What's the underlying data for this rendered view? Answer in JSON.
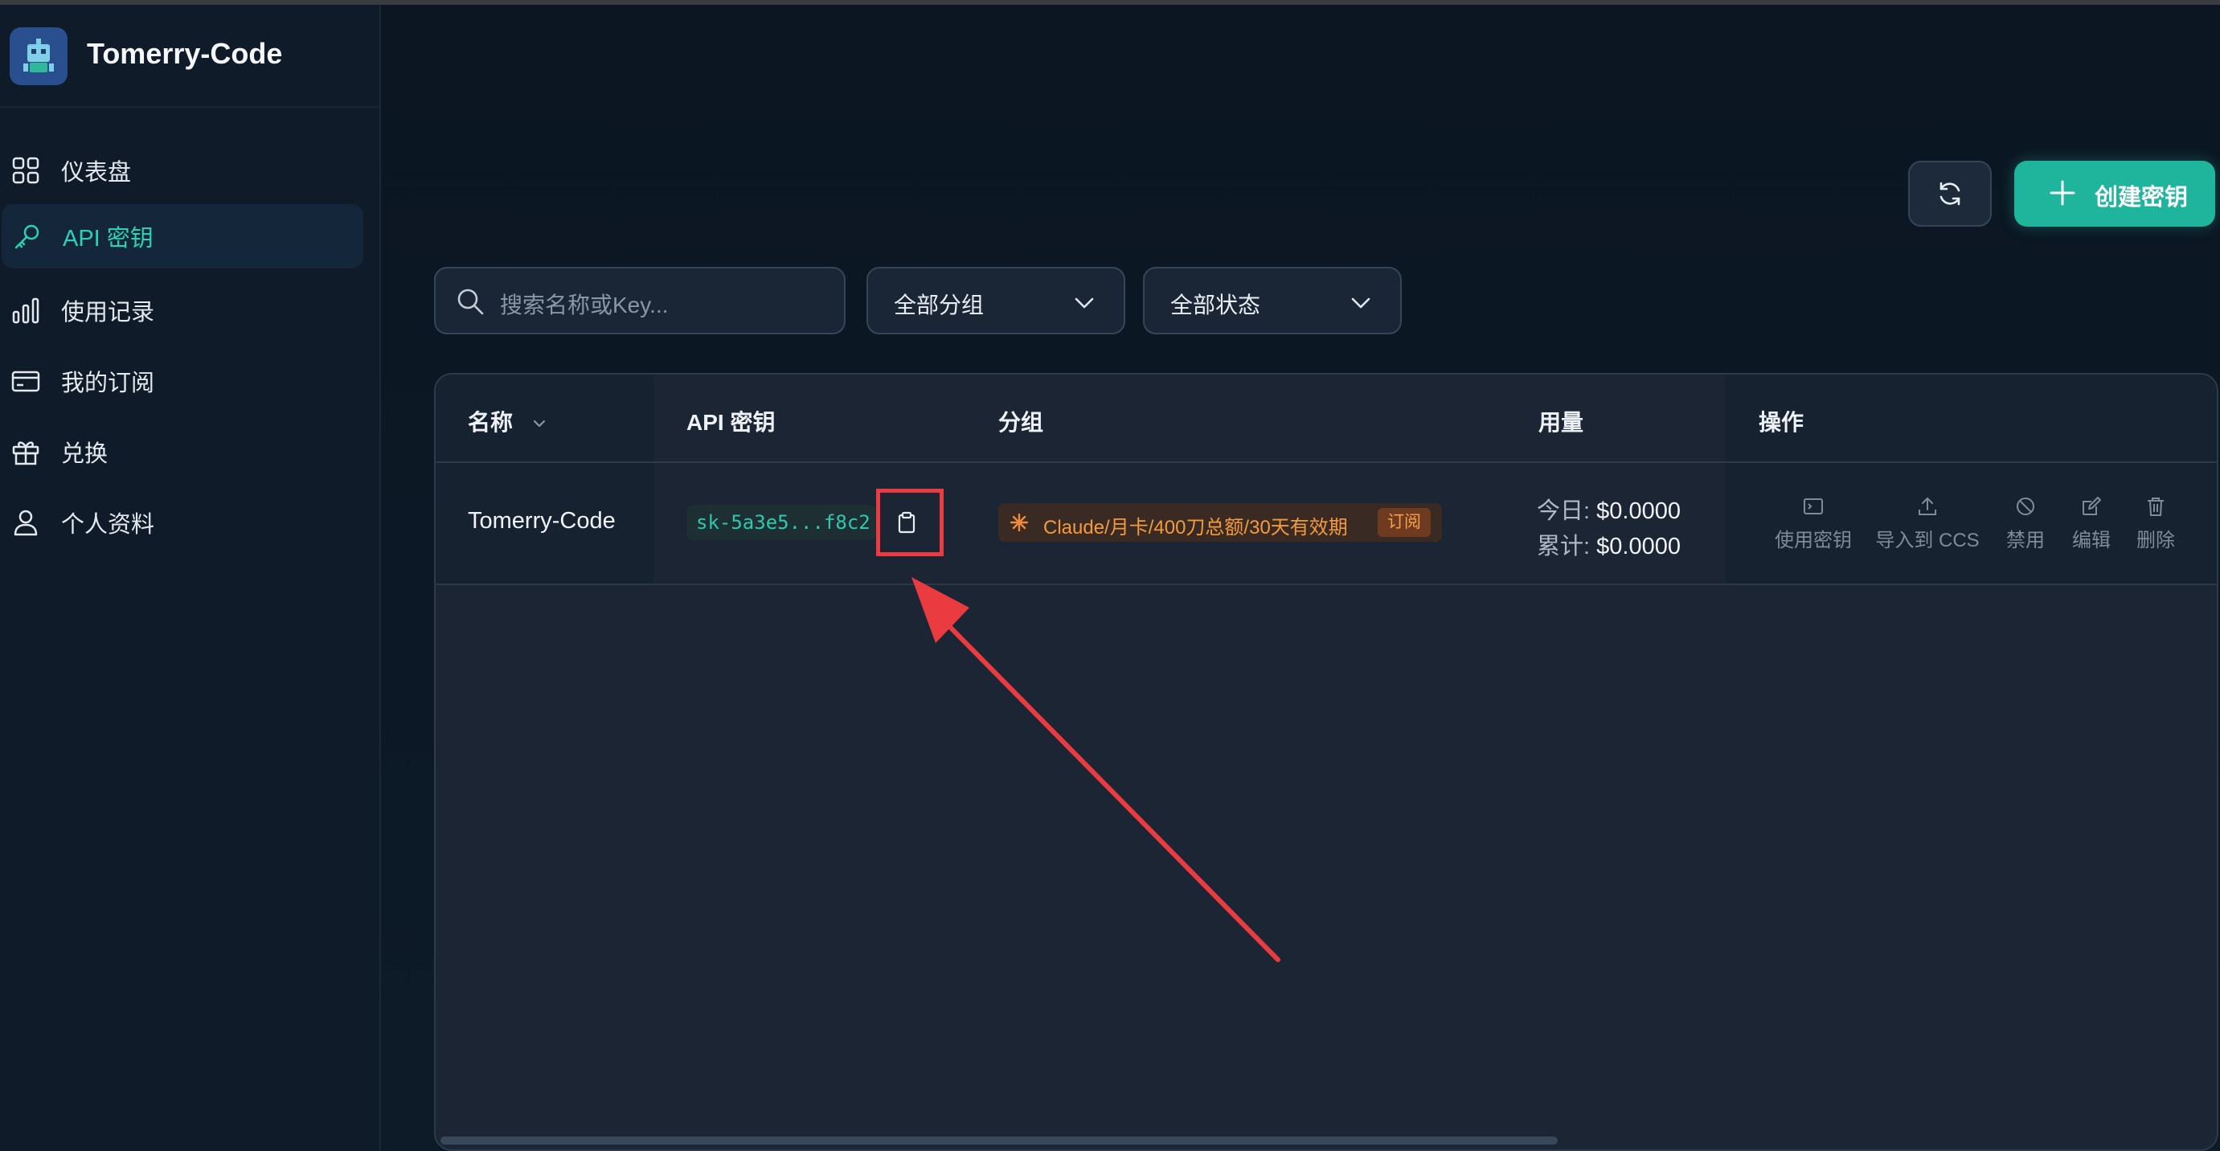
{
  "app": {
    "name": "Tomerry-Code"
  },
  "sidebar": {
    "items": [
      {
        "label": "仪表盘",
        "icon": "grid-icon",
        "active": false
      },
      {
        "label": "API 密钥",
        "icon": "key-icon",
        "active": true
      },
      {
        "label": "使用记录",
        "icon": "bar-chart-icon",
        "active": false
      },
      {
        "label": "我的订阅",
        "icon": "credit-card-icon",
        "active": false
      },
      {
        "label": "兑换",
        "icon": "gift-icon",
        "active": false
      },
      {
        "label": "个人资料",
        "icon": "user-icon",
        "active": false
      }
    ]
  },
  "toolbar": {
    "create_label": "创建密钥"
  },
  "filters": {
    "search_placeholder": "搜索名称或Key...",
    "group_select": "全部分组",
    "status_select": "全部状态"
  },
  "table": {
    "headers": {
      "name": "名称",
      "key": "API 密钥",
      "group": "分组",
      "usage": "用量",
      "actions": "操作"
    },
    "rows": [
      {
        "name": "Tomerry-Code",
        "key": "sk-5a3e5...f8c2",
        "group": "Claude/月卡/400刀总额/30天有效期",
        "group_tag": "订阅",
        "usage_today_label": "今日:",
        "usage_today": "$0.0000",
        "usage_total_label": "累计:",
        "usage_total": "$0.0000",
        "actions": [
          "使用密钥",
          "导入到 CCS",
          "禁用",
          "编辑",
          "删除"
        ]
      }
    ]
  },
  "colors": {
    "accent": "#1fb59c",
    "annotation": "#ea3b41",
    "badge_text": "#f49a3b"
  }
}
